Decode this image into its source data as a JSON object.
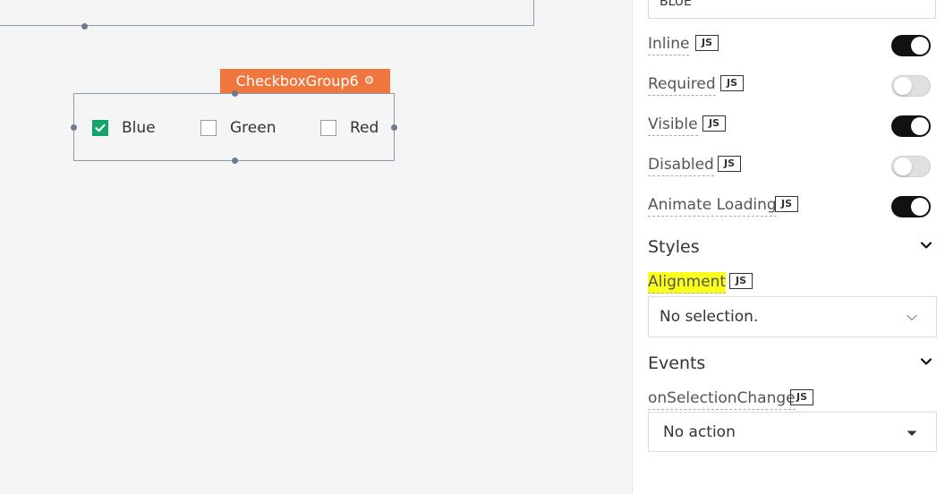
{
  "canvas": {
    "widget_tag": {
      "label": "CheckboxGroup6",
      "icon": "gear-icon"
    },
    "checkbox_group": {
      "options": [
        {
          "label": "Blue",
          "checked": true
        },
        {
          "label": "Green",
          "checked": false
        },
        {
          "label": "Red",
          "checked": false
        }
      ]
    }
  },
  "panel": {
    "top_input_value": "BLUE",
    "properties": [
      {
        "label": "Inline",
        "js": "JS",
        "on": true
      },
      {
        "label": "Required",
        "js": "JS",
        "on": false
      },
      {
        "label": "Visible",
        "js": "JS",
        "on": true
      },
      {
        "label": "Disabled",
        "js": "JS",
        "on": false
      },
      {
        "label": "Animate Loading",
        "js": "JS",
        "on": true
      }
    ],
    "styles": {
      "title": "Styles",
      "alignment_label": "Alignment",
      "alignment_js": "JS",
      "alignment_value": "No selection."
    },
    "events": {
      "title": "Events",
      "on_selection_change_label": "onSelectionChange",
      "on_selection_change_js": "JS",
      "on_selection_change_value": "No action"
    }
  },
  "colors": {
    "widget_tag": "#f0763f",
    "checkbox_checked": "#13a46a",
    "toggle_on": "#111111",
    "highlight": "#fbff1c"
  }
}
